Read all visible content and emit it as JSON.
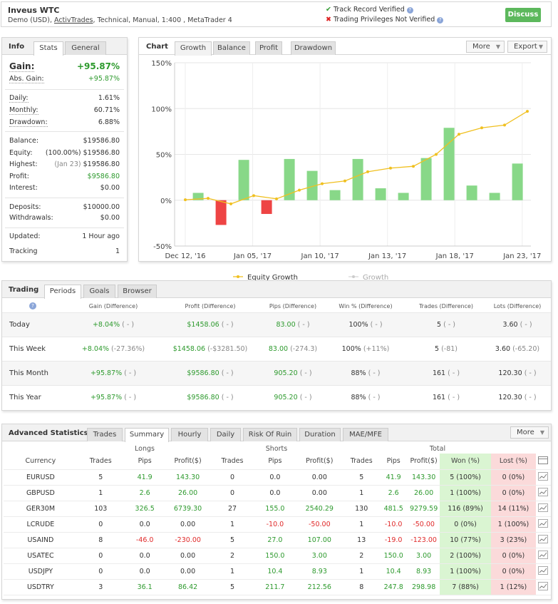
{
  "header": {
    "title": "Inveus WTC",
    "sub_prefix": "Demo (USD), ",
    "broker": "ActivTrades",
    "sub_suffix": ", Technical, Manual, 1:400 , MetaTrader 4",
    "verify1": "Track Record Verified",
    "verify2": "Trading Privileges Not Verified",
    "discuss": "Discuss",
    "green_color": "#5cb85c"
  },
  "info": {
    "title": "Info",
    "tabs": [
      "Stats",
      "General"
    ],
    "gain_label": "Gain:",
    "gain_value": "+95.87%",
    "abs_gain_label": "Abs. Gain:",
    "abs_gain_value": "+95.87%",
    "daily_label": "Daily:",
    "daily_value": "1.61%",
    "monthly_label": "Monthly:",
    "monthly_value": "60.71%",
    "drawdown_label": "Drawdown:",
    "drawdown_value": "6.88%",
    "balance_label": "Balance:",
    "balance_value": "$19586.80",
    "equity_label": "Equity:",
    "equity_pct": "(100.00%)",
    "equity_value": "$19586.80",
    "highest_label": "Highest:",
    "highest_date": "(Jan 23)",
    "highest_value": "$19586.80",
    "profit_label": "Profit:",
    "profit_value": "$9586.80",
    "interest_label": "Interest:",
    "interest_value": "$0.00",
    "deposits_label": "Deposits:",
    "deposits_value": "$10000.00",
    "withdrawals_label": "Withdrawals:",
    "withdrawals_value": "$0.00",
    "updated_label": "Updated:",
    "updated_value": "1 Hour ago",
    "tracking_label": "Tracking",
    "tracking_value": "1"
  },
  "chart_panel": {
    "title": "Chart",
    "tabs": [
      "Growth",
      "Balance",
      "Profit",
      "Drawdown"
    ],
    "more": "More",
    "export": "Export"
  },
  "chart_data": {
    "type": "bar",
    "title": "",
    "series": [
      {
        "name": "Equity Growth",
        "type": "line",
        "color": "#f0c020",
        "values": [
          0.5,
          2,
          -4,
          5,
          1.5,
          11,
          18,
          21,
          31,
          35,
          37,
          50,
          72,
          79,
          82,
          97
        ]
      },
      {
        "name": "Growth",
        "type": "bar",
        "values": [
          8,
          -27,
          44,
          -15,
          45,
          32,
          11,
          45,
          13,
          8,
          46,
          79,
          16,
          8,
          40
        ]
      }
    ],
    "x_ticks": [
      "Dec 12, '16",
      "Jan 05, '17",
      "Jan 10, '17",
      "Jan 13, '17",
      "Jan 18, '17",
      "Jan 23, '17"
    ],
    "y_ticks": [
      "150%",
      "100%",
      "50%",
      "0%",
      "-50%"
    ],
    "ylim": [
      -50,
      150
    ],
    "grid": true,
    "legend": "bottom",
    "pos_color": "#88d888",
    "neg_color": "#ee4444"
  },
  "trading": {
    "title": "Trading",
    "tabs": [
      "Periods",
      "Goals",
      "Browser"
    ],
    "help": "?",
    "headers": [
      "Gain (Difference)",
      "Profit (Difference)",
      "Pips (Difference)",
      "Win % (Difference)",
      "Trades (Difference)",
      "Lots (Difference)"
    ],
    "rows": [
      {
        "label": "Today",
        "gain": "+8.04%",
        "gain_d": "( - )",
        "profit": "$1458.06",
        "profit_d": "( - )",
        "pips": "83.00",
        "pips_d": "( - )",
        "win": "100%",
        "win_d": "( - )",
        "trades": "5",
        "trades_d": "( - )",
        "lots": "3.60",
        "lots_d": "( - )"
      },
      {
        "label": "This Week",
        "gain": "+8.04%",
        "gain_d": "(-27.36%)",
        "profit": "$1458.06",
        "profit_d": "(-$3281.50)",
        "pips": "83.00",
        "pips_d": "(-274.3)",
        "win": "100%",
        "win_d": "(+11%)",
        "trades": "5",
        "trades_d": "(-81)",
        "lots": "3.60",
        "lots_d": "(-65.20)"
      },
      {
        "label": "This Month",
        "gain": "+95.87%",
        "gain_d": "( - )",
        "profit": "$9586.80",
        "profit_d": "( - )",
        "pips": "905.20",
        "pips_d": "( - )",
        "win": "88%",
        "win_d": "( - )",
        "trades": "161",
        "trades_d": "( - )",
        "lots": "120.30",
        "lots_d": "( - )"
      },
      {
        "label": "This Year",
        "gain": "+95.87%",
        "gain_d": "( - )",
        "profit": "$9586.80",
        "profit_d": "( - )",
        "pips": "905.20",
        "pips_d": "( - )",
        "win": "88%",
        "win_d": "( - )",
        "trades": "161",
        "trades_d": "( - )",
        "lots": "120.30",
        "lots_d": "( - )"
      }
    ]
  },
  "advanced": {
    "title": "Advanced Statistics",
    "tabs": [
      "Trades",
      "Summary",
      "Hourly",
      "Daily",
      "Risk Of Ruin",
      "Duration",
      "MAE/MFE"
    ],
    "more": "More",
    "groups": [
      "Longs",
      "Shorts",
      "Total"
    ],
    "columns": [
      "Currency",
      "Trades",
      "Pips",
      "Profit($)",
      "Trades",
      "Pips",
      "Profit($)",
      "Trades",
      "Pips",
      "Profit($)",
      "Won (%)",
      "Lost (%)"
    ],
    "rows": [
      [
        "EURUSD",
        "5",
        "41.9",
        "143.30",
        "0",
        "0.0",
        "0.00",
        "5",
        "41.9",
        "143.30",
        "5 (100%)",
        "0 (0%)"
      ],
      [
        "GBPUSD",
        "1",
        "2.6",
        "26.00",
        "0",
        "0.0",
        "0.00",
        "1",
        "2.6",
        "26.00",
        "1 (100%)",
        "0 (0%)"
      ],
      [
        "GER30M",
        "103",
        "326.5",
        "6739.30",
        "27",
        "155.0",
        "2540.29",
        "130",
        "481.5",
        "9279.59",
        "116 (89%)",
        "14 (11%)"
      ],
      [
        "LCRUDE",
        "0",
        "0.0",
        "0.00",
        "1",
        "-10.0",
        "-50.00",
        "1",
        "-10.0",
        "-50.00",
        "0 (0%)",
        "1 (100%)"
      ],
      [
        "USAIND",
        "8",
        "-46.0",
        "-230.00",
        "5",
        "27.0",
        "107.00",
        "13",
        "-19.0",
        "-123.00",
        "10 (77%)",
        "3 (23%)"
      ],
      [
        "USATEC",
        "0",
        "0.0",
        "0.00",
        "2",
        "150.0",
        "3.00",
        "2",
        "150.0",
        "3.00",
        "2 (100%)",
        "0 (0%)"
      ],
      [
        "USDJPY",
        "0",
        "0.0",
        "0.00",
        "1",
        "10.4",
        "8.93",
        "1",
        "10.4",
        "8.93",
        "1 (100%)",
        "0 (0%)"
      ],
      [
        "USDTRY",
        "3",
        "36.1",
        "86.42",
        "5",
        "211.7",
        "212.56",
        "8",
        "247.8",
        "298.98",
        "7 (88%)",
        "1 (12%)"
      ]
    ]
  }
}
